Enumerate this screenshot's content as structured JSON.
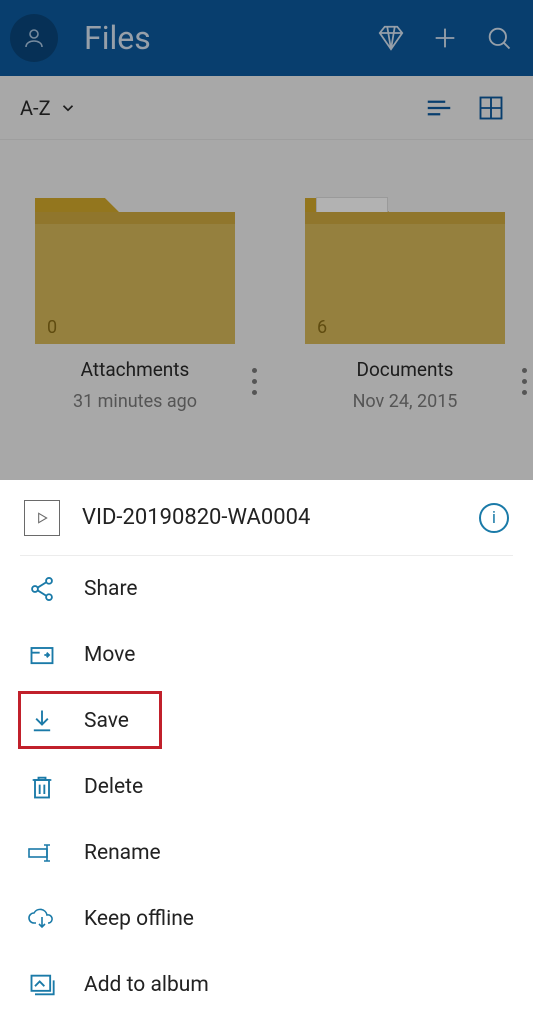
{
  "header": {
    "title": "Files"
  },
  "sortbar": {
    "sort_label": "A-Z"
  },
  "folders": [
    {
      "name": "Attachments",
      "count": "0",
      "subtitle": "31 minutes ago",
      "has_paper": false
    },
    {
      "name": "Documents",
      "count": "6",
      "subtitle": "Nov 24, 2015",
      "has_paper": true
    }
  ],
  "sheet": {
    "file_name": "VID-20190820-WA0004",
    "actions": {
      "share": "Share",
      "move": "Move",
      "save": "Save",
      "delete": "Delete",
      "rename": "Rename",
      "keep_offline": "Keep offline",
      "add_to_album": "Add to album"
    }
  }
}
